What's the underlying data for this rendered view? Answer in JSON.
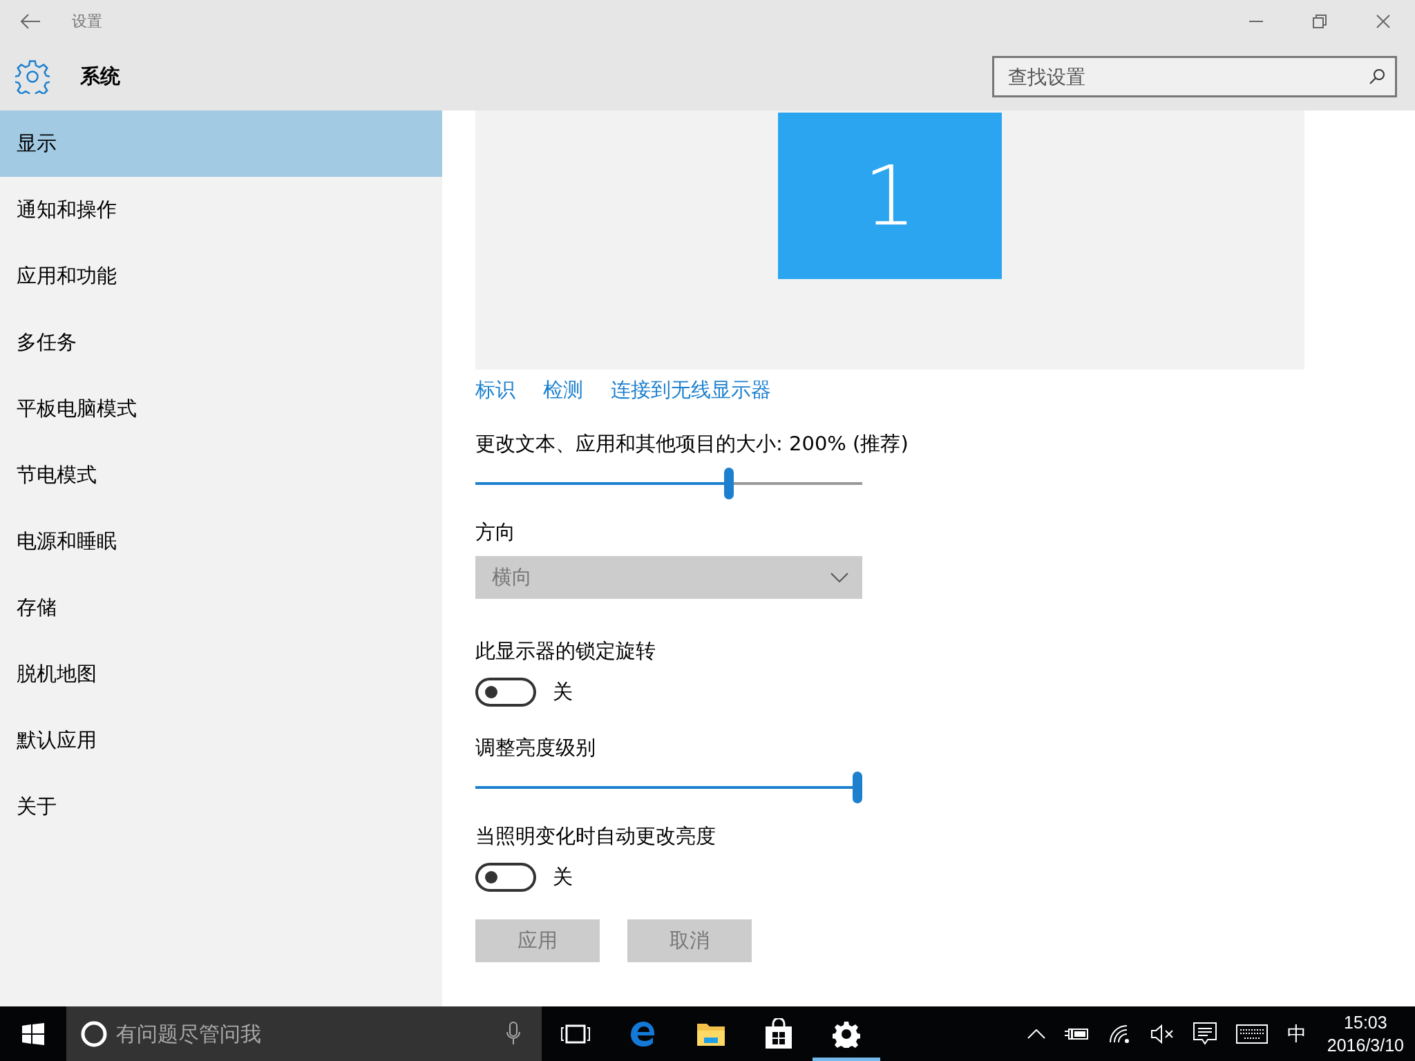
{
  "window": {
    "title": "设置"
  },
  "header": {
    "title": "系统",
    "search": {
      "placeholder": "查找设置"
    }
  },
  "sidebar": {
    "items": [
      {
        "label": "显示",
        "selected": true
      },
      {
        "label": "通知和操作",
        "selected": false
      },
      {
        "label": "应用和功能",
        "selected": false
      },
      {
        "label": "多任务",
        "selected": false
      },
      {
        "label": "平板电脑模式",
        "selected": false
      },
      {
        "label": "节电模式",
        "selected": false
      },
      {
        "label": "电源和睡眠",
        "selected": false
      },
      {
        "label": "存储",
        "selected": false
      },
      {
        "label": "脱机地图",
        "selected": false
      },
      {
        "label": "默认应用",
        "selected": false
      },
      {
        "label": "关于",
        "selected": false
      }
    ]
  },
  "display": {
    "monitor": "1",
    "links": [
      "标识",
      "检测",
      "连接到无线显示器"
    ]
  },
  "settings": [
    {
      "kind": "slider",
      "label": "更改文本、应用和其他项目的大小: 200% (推荐)",
      "level": 0.66
    },
    {
      "kind": "dropdown",
      "label": "方向",
      "value": "横向",
      "disabled": true
    },
    {
      "kind": "toggle",
      "label": "此显示器的锁定旋转",
      "on": false,
      "state": "关"
    },
    {
      "kind": "slider",
      "label": "调整亮度级别",
      "level": 1
    },
    {
      "kind": "toggle",
      "label": "当照明变化时自动更改亮度",
      "on": false,
      "state": "关"
    }
  ],
  "buttons": [
    {
      "label": "应用",
      "disabled": true
    },
    {
      "label": "取消",
      "disabled": true
    }
  ],
  "taskbar": {
    "search": {
      "placeholder": "有问题尽管问我"
    },
    "apps": [
      {
        "kind": "taskview",
        "active": false
      },
      {
        "kind": "edge",
        "active": false
      },
      {
        "kind": "explorer",
        "active": false
      },
      {
        "kind": "store",
        "active": false
      },
      {
        "kind": "settings",
        "active": true
      }
    ],
    "ime": "中",
    "time": "15:03",
    "date": "2016/3/10"
  }
}
